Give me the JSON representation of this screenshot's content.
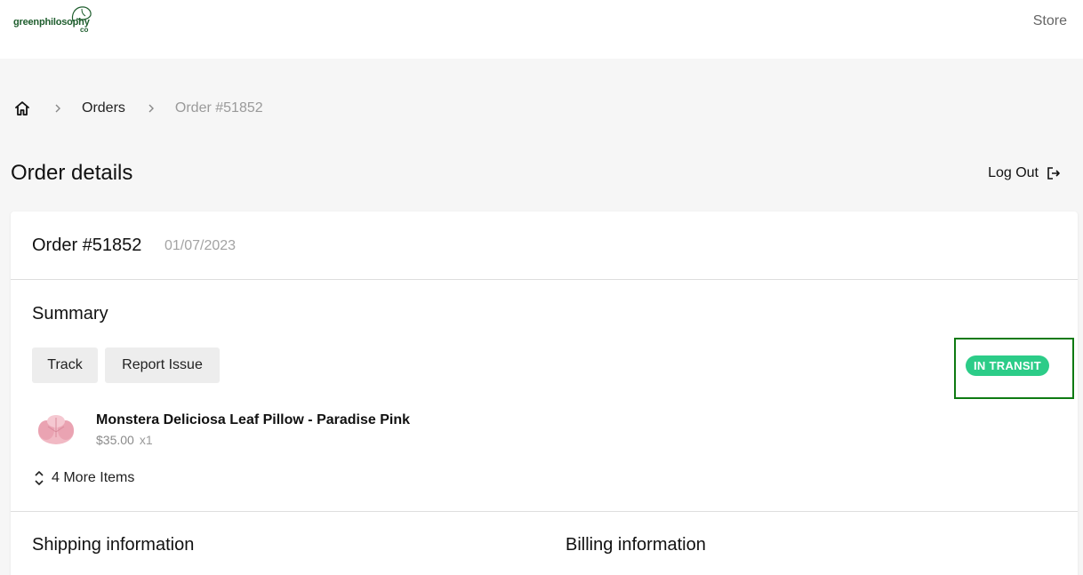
{
  "header": {
    "logo": {
      "wordmark": "greenphilosophy",
      "suffix": "co"
    },
    "store_label": "Store"
  },
  "breadcrumb": {
    "items": [
      {
        "label": "Orders"
      },
      {
        "label": "Order #51852"
      }
    ]
  },
  "page": {
    "title": "Order details",
    "logout_label": "Log Out"
  },
  "order": {
    "number": "Order #51852",
    "date": "01/07/2023",
    "summary_title": "Summary",
    "actions": {
      "track_label": "Track",
      "report_label": "Report Issue"
    },
    "status": {
      "label": "IN TRANSIT",
      "color": "#2ccc88"
    },
    "items": [
      {
        "name": "Monstera Deliciosa Leaf Pillow - Paradise Pink",
        "price": "$35.00",
        "qty": "x1"
      }
    ],
    "more_items_label": "4 More Items",
    "shipping_title": "Shipping information",
    "billing_title": "Billing information"
  },
  "colors": {
    "brand": "#1f5e2e",
    "status": "#2ccc88",
    "highlight": "#0e7a12"
  },
  "icons": [
    "home-icon",
    "chevron-right-icon",
    "logout-icon",
    "expand-icon"
  ]
}
